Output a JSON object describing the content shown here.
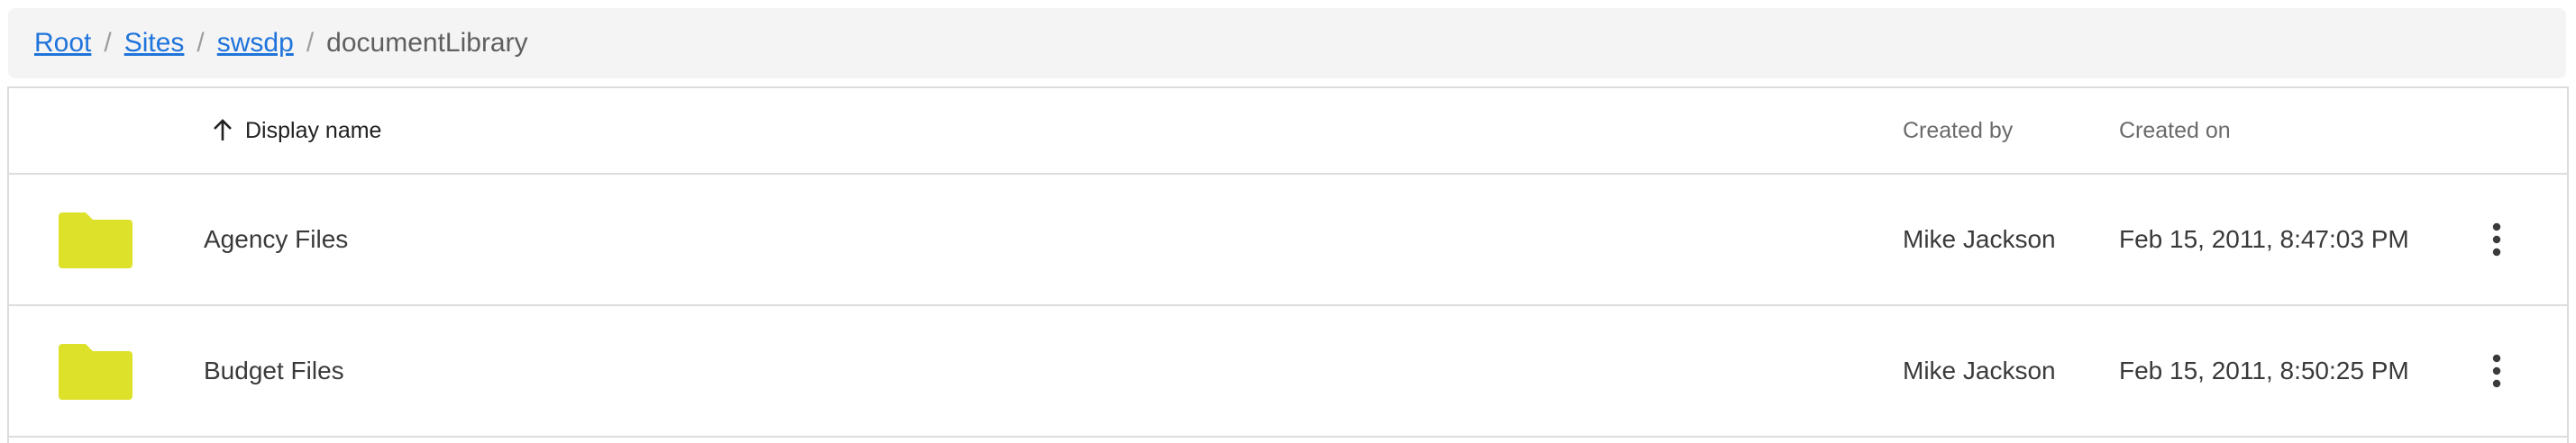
{
  "breadcrumb": {
    "items": [
      {
        "label": "Root"
      },
      {
        "label": "Sites"
      },
      {
        "label": "swsdp"
      }
    ],
    "current": "documentLibrary",
    "separator": "/"
  },
  "table": {
    "columns": {
      "name": "Display name",
      "created_by": "Created by",
      "created_on": "Created on"
    },
    "sort": {
      "column": "name",
      "direction": "ascending",
      "icon": "arrow-up-icon"
    },
    "rows": [
      {
        "name": "Agency Files",
        "created_by": "Mike Jackson",
        "created_on": "Feb 15, 2011, 8:47:03 PM",
        "icon": "folder-icon"
      },
      {
        "name": "Budget Files",
        "created_by": "Mike Jackson",
        "created_on": "Feb 15, 2011, 8:50:25 PM",
        "icon": "folder-icon"
      }
    ],
    "row_action_icon": "more-vertical-icon"
  },
  "colors": {
    "folder": "#dde12a",
    "link": "#1f74db",
    "breadcrumb_bg": "#f4f4f4",
    "border": "#dcdcdc"
  }
}
